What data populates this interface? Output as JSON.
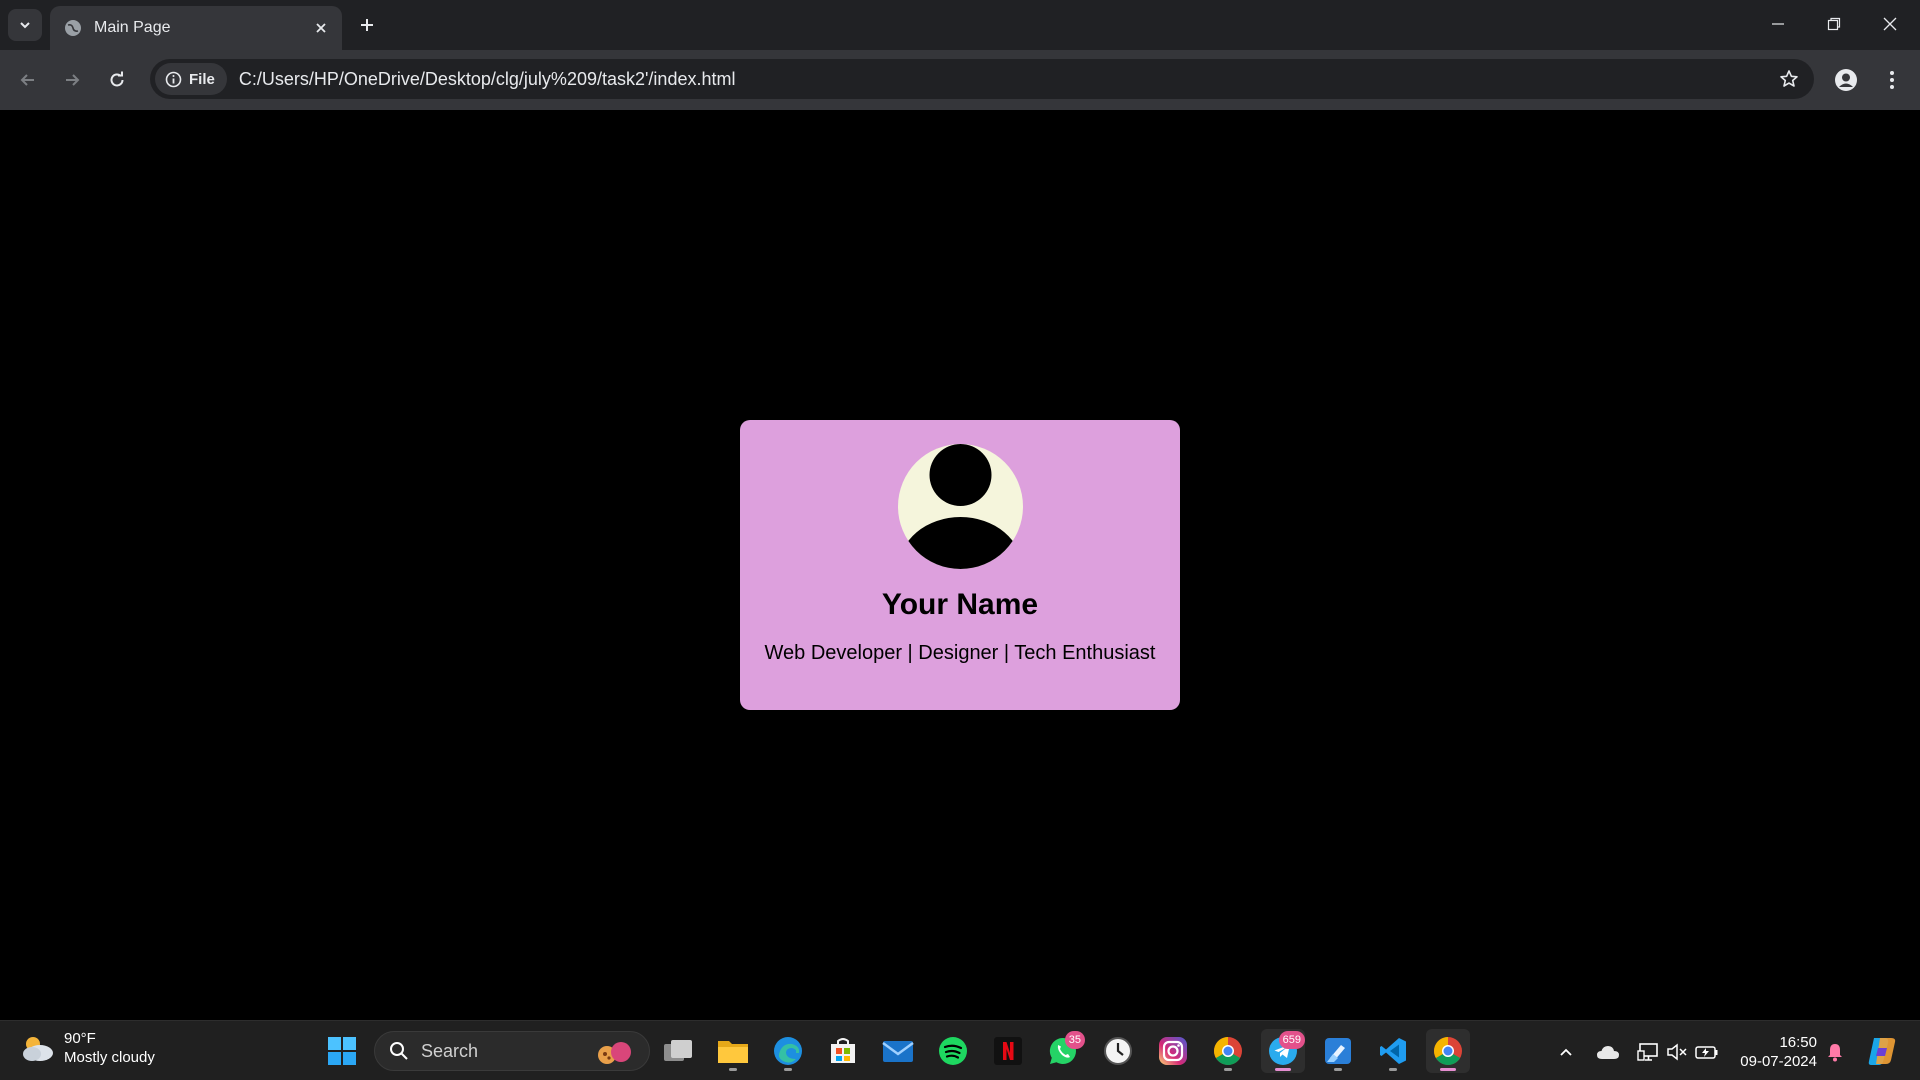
{
  "browser": {
    "tab_title": "Main Page",
    "site_info_label": "File",
    "url": "C:/Users/HP/OneDrive/Desktop/clg/july%209/task2'/index.html"
  },
  "card": {
    "name": "Your Name",
    "tagline": "Web Developer | Designer | Tech Enthusiast",
    "background_color": "#dda0dd",
    "avatar_background_color": "#f5f5dc"
  },
  "taskbar": {
    "weather_temp": "90°F",
    "weather_desc": "Mostly cloudy",
    "search_label": "Search",
    "whatsapp_badge": "35",
    "telegram_badge": "659",
    "time": "16:50",
    "date": "09-07-2024"
  }
}
